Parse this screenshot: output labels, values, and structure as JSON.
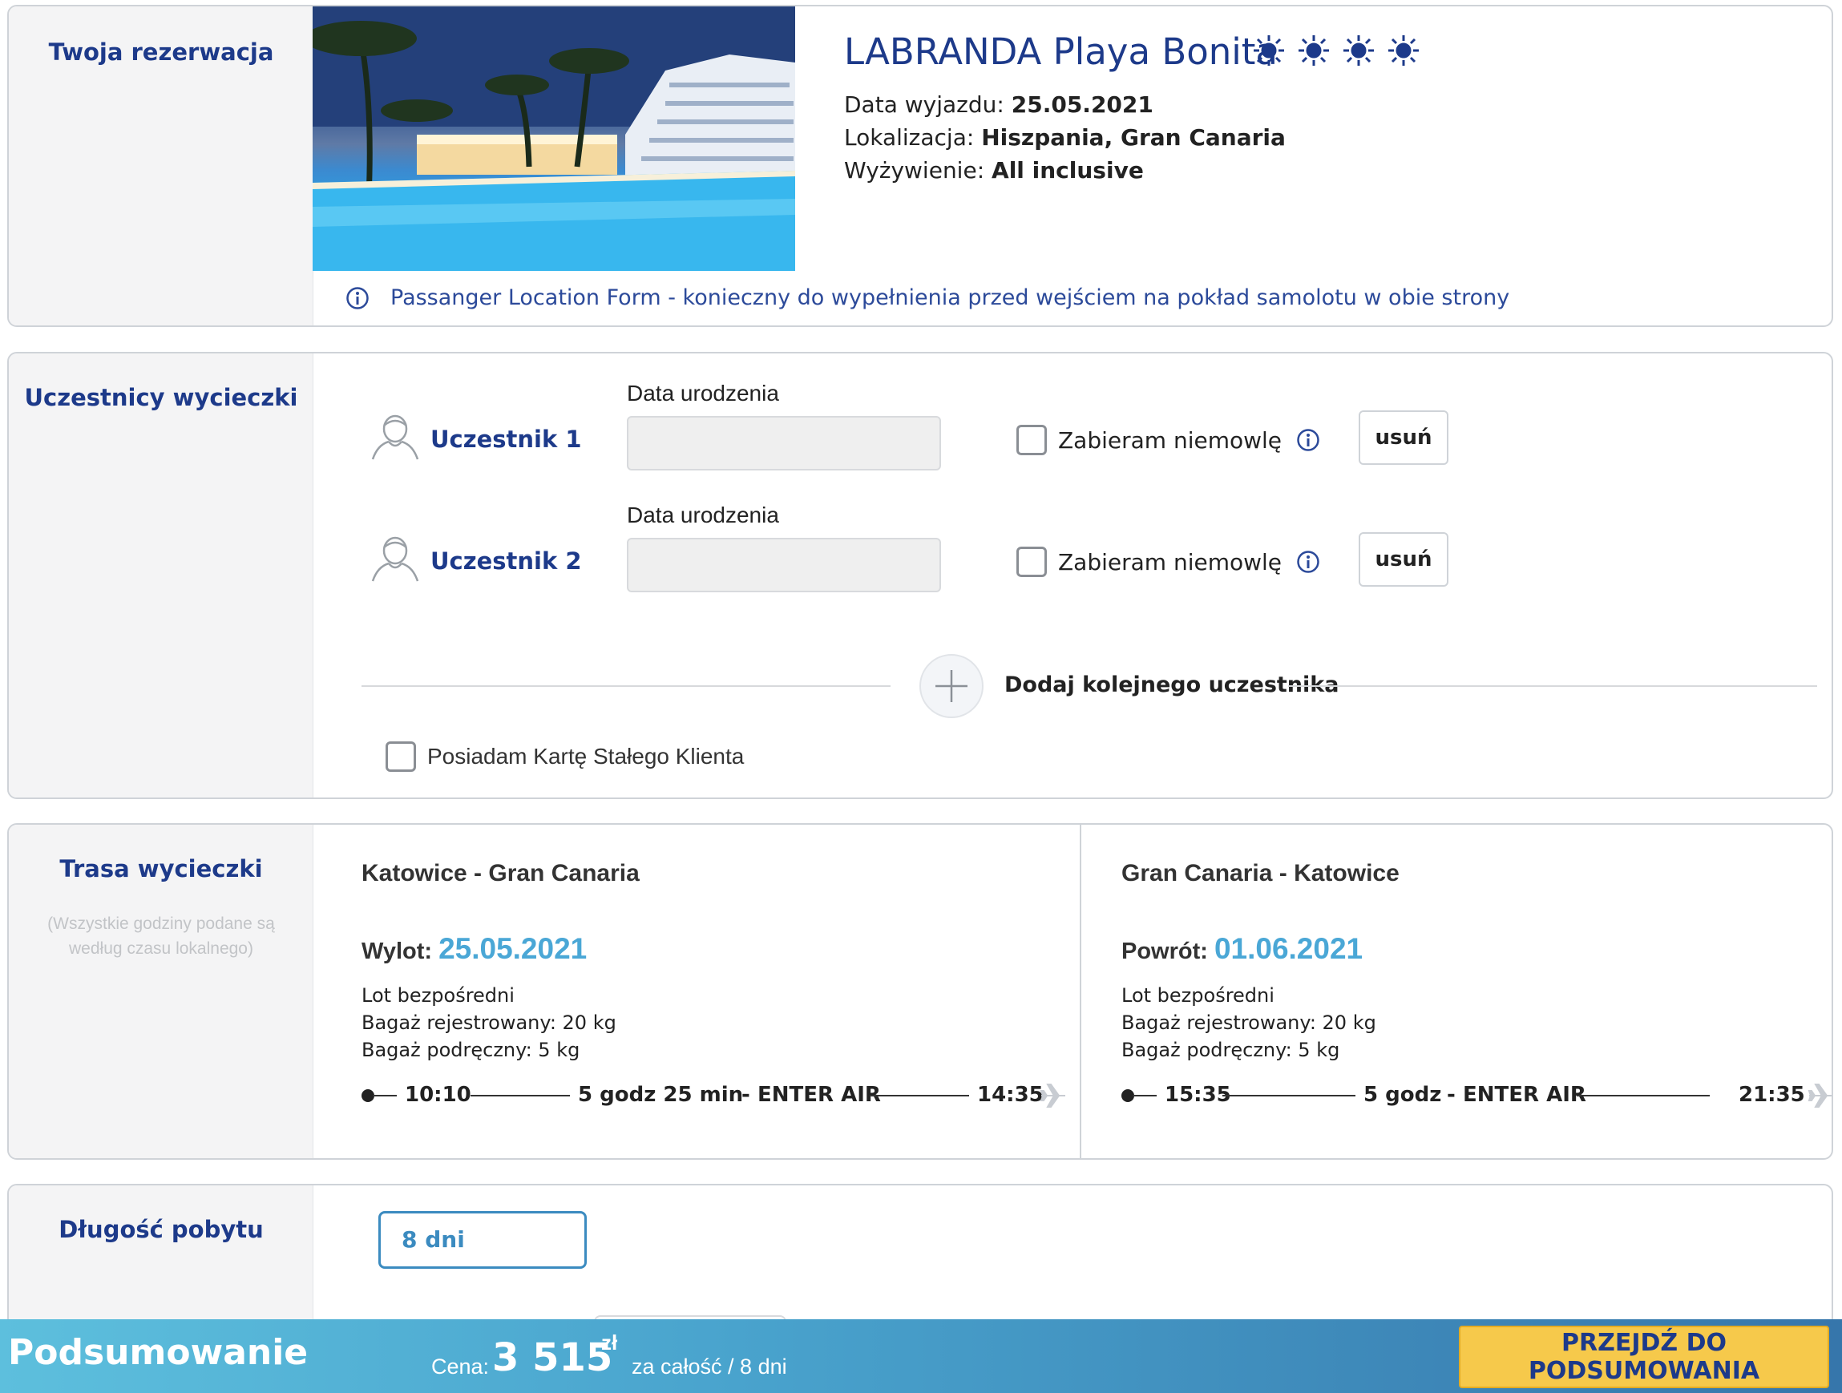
{
  "booking": {
    "section_title": "Twoja rezerwacja",
    "hotel_name": "LABRANDA Playa Bonita",
    "rating_suns": 4,
    "departure_label": "Data wyjazdu:",
    "departure_value": "25.05.2021",
    "location_label": "Lokalizacja:",
    "location_value": "Hiszpania, Gran Canaria",
    "board_label": "Wyżywienie:",
    "board_value": "All inclusive",
    "plf_notice": "Passanger Location Form - konieczny do wypełnienia przed wejściem na pokład samolotu w obie strony"
  },
  "participants": {
    "section_title": "Uczestnicy wycieczki",
    "items": [
      {
        "name": "Uczestnik 1",
        "dob_label": "Data urodzenia",
        "dob_value": "",
        "infant_label": "Zabieram niemowlę",
        "remove_label": "usuń"
      },
      {
        "name": "Uczestnik 2",
        "dob_label": "Data urodzenia",
        "dob_value": "",
        "infant_label": "Zabieram niemowlę",
        "remove_label": "usuń"
      }
    ],
    "add_label": "Dodaj kolejnego uczestnika",
    "loyalty_label": "Posiadam Kartę Stałego Klienta"
  },
  "route": {
    "section_title": "Trasa wycieczki",
    "note": "(Wszystkie godziny podane są według czasu lokalnego)",
    "outbound": {
      "title": "Katowice - Gran Canaria",
      "date_label": "Wylot:",
      "date_value": "25.05.2021",
      "flight_type": "Lot bezpośredni",
      "checked_baggage": "Bagaż rejestrowany: 20 kg",
      "hand_baggage": "Bagaż podręczny: 5 kg",
      "depart_time": "10:10",
      "duration": "5 godz 25 min",
      "separator": "-",
      "carrier": "ENTER AIR",
      "arrive_time": "14:35"
    },
    "return": {
      "title": "Gran Canaria - Katowice",
      "date_label": "Powrót:",
      "date_value": "01.06.2021",
      "flight_type": "Lot bezpośredni",
      "checked_baggage": "Bagaż rejestrowany: 20 kg",
      "hand_baggage": "Bagaż podręczny: 5 kg",
      "depart_time": "15:35",
      "duration": "5 godz",
      "separator": "-",
      "carrier": "ENTER AIR",
      "arrive_time": "21:35"
    }
  },
  "stay": {
    "section_title": "Długość pobytu",
    "selected": "8 dni"
  },
  "summary": {
    "title": "Podsumowanie",
    "price_label": "Cena:",
    "price_value": "3 515",
    "currency": "zł",
    "price_suffix": "za całość / 8 dni",
    "cta_label": "PRZEJDŹ DO PODSUMOWANIA"
  },
  "colors": {
    "brand_blue": "#1d3a8a",
    "accent_light_blue": "#4aa7d6",
    "cta_yellow": "#f6c94b"
  }
}
